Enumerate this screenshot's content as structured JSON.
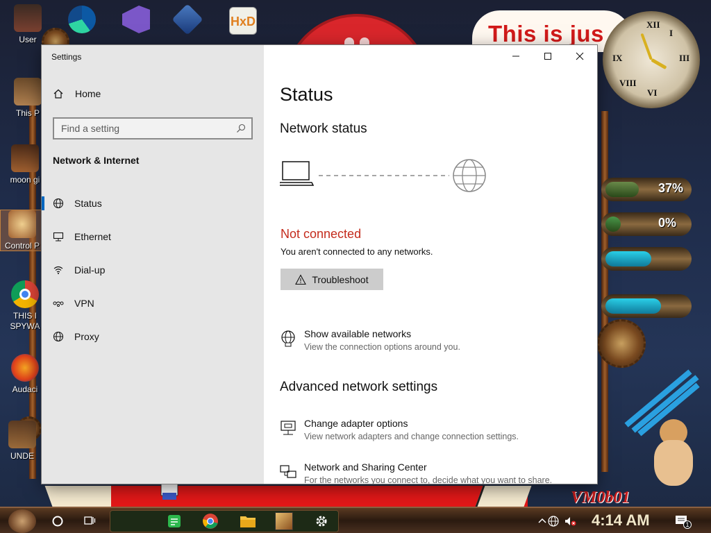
{
  "desktop": {
    "icons": [
      {
        "label": "User"
      },
      {
        "label": "This P"
      },
      {
        "label": "moon gi"
      },
      {
        "label": "Control P"
      },
      {
        "label": "THIS I SPYWA"
      },
      {
        "label": "Audaci"
      },
      {
        "label": "UNDE"
      }
    ],
    "top_icons": [
      {
        "label": "",
        "name": "edge-icon"
      },
      {
        "label": "",
        "name": "visual-studio-icon"
      },
      {
        "label": "",
        "name": "virtualbox-icon"
      },
      {
        "label": "",
        "name": "hxd-icon"
      }
    ],
    "background_text": "This is jus",
    "signature": "VM0b01",
    "gauges": [
      {
        "pct_label": "37%",
        "level": 0.37,
        "color": "#6a8a4a"
      },
      {
        "pct_label": "0%",
        "level": 0.0,
        "color": "#4a9a4a"
      }
    ]
  },
  "settings": {
    "app_title": "Settings",
    "home_label": "Home",
    "search_placeholder": "Find a setting",
    "section_title": "Network & Internet",
    "nav_items": [
      {
        "label": "Status",
        "icon": "globe-icon",
        "active": true
      },
      {
        "label": "Ethernet",
        "icon": "ethernet-icon",
        "active": false
      },
      {
        "label": "Dial-up",
        "icon": "dialup-icon",
        "active": false
      },
      {
        "label": "VPN",
        "icon": "vpn-icon",
        "active": false
      },
      {
        "label": "Proxy",
        "icon": "globe-icon",
        "active": false
      }
    ],
    "main": {
      "page_title": "Status",
      "network_status_heading": "Network status",
      "status_text": "Not connected",
      "status_description": "You aren't connected to any networks.",
      "troubleshoot_label": "Troubleshoot",
      "show_networks": {
        "title": "Show available networks",
        "desc": "View the connection options around you."
      },
      "advanced_heading": "Advanced network settings",
      "adapter_options": {
        "title": "Change adapter options",
        "desc": "View network adapters and change connection settings."
      },
      "sharing_center": {
        "title": "Network and Sharing Center",
        "desc": "For the networks you connect to, decide what you want to share."
      }
    },
    "colors": {
      "accent": "#0067c0",
      "error": "#c42b1c",
      "sidebar_bg": "#e6e6e6"
    }
  },
  "taskbar": {
    "time": "4:14 AM",
    "notification_count": "1"
  }
}
